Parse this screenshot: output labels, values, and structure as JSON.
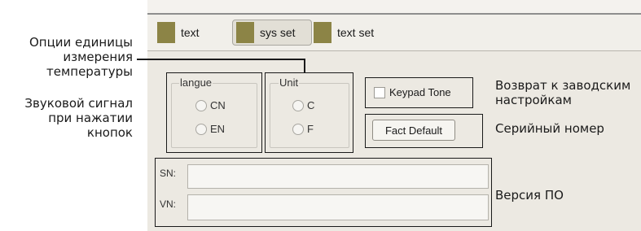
{
  "tabs": [
    {
      "label": "text"
    },
    {
      "label": "sys set"
    },
    {
      "label": "text set"
    }
  ],
  "language_group": {
    "title": "langue",
    "options": [
      {
        "label": "CN"
      },
      {
        "label": "EN"
      }
    ]
  },
  "unit_group": {
    "title": "Unit",
    "options": [
      {
        "label": "C"
      },
      {
        "label": "F"
      }
    ]
  },
  "keypad_tone": {
    "label": "Keypad Tone"
  },
  "fact_default": {
    "label": "Fact Default"
  },
  "sn": {
    "label": "SN:",
    "value": ""
  },
  "vn": {
    "label": "VN:",
    "value": ""
  },
  "annotations": {
    "unit_options": [
      "Опции единицы",
      "измерения",
      "температуры"
    ],
    "key_sound": [
      "Звуковой сигнал",
      "при нажатии",
      "кнопок"
    ],
    "factory_reset": [
      "Возврат к заводским",
      "настройкам"
    ],
    "serial_number": "Серийный номер",
    "software_version": "Версия ПО"
  },
  "colors": {
    "panel_bg": "#ece9e2",
    "tab_icon": "#8c8446",
    "annotation_line": "#1a1a1a"
  }
}
